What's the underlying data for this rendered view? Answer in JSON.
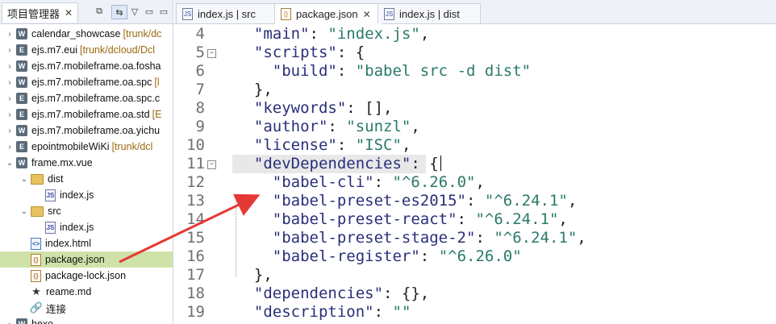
{
  "left_panel": {
    "title": "项目管理器",
    "close": "✕",
    "toolbar": [
      "⧉",
      "⇆",
      "▽",
      "▭",
      "▭"
    ],
    "tree": [
      {
        "twisty": "›",
        "icon": "proj",
        "icon_text": "W",
        "name": "calendar_showcase",
        "meta": "[trunk/dc"
      },
      {
        "twisty": "›",
        "icon": "proj",
        "icon_text": "E",
        "name": "ejs.m7.eui",
        "meta": "[trunk/dcloud/Dcl"
      },
      {
        "twisty": "›",
        "icon": "proj",
        "icon_text": "W",
        "name": "ejs.m7.mobileframe.oa.fosha",
        "meta": ""
      },
      {
        "twisty": "›",
        "icon": "proj",
        "icon_text": "W",
        "name": "ejs.m7.mobileframe.oa.spc",
        "meta": "[l"
      },
      {
        "twisty": "›",
        "icon": "proj",
        "icon_text": "E",
        "name": "ejs.m7.mobileframe.oa.spc.c",
        "meta": ""
      },
      {
        "twisty": "›",
        "icon": "proj",
        "icon_text": "E",
        "name": "ejs.m7.mobileframe.oa.std",
        "meta": "[E"
      },
      {
        "twisty": "›",
        "icon": "proj",
        "icon_text": "W",
        "name": "ejs.m7.mobileframe.oa.yichu",
        "meta": ""
      },
      {
        "twisty": "›",
        "icon": "proj",
        "icon_text": "E",
        "name": "epointmobileWiKi",
        "meta": "[trunk/dcl"
      },
      {
        "twisty": "⌄",
        "icon": "proj",
        "icon_text": "W",
        "name": "frame.mx.vue",
        "meta": ""
      },
      {
        "twisty": "⌄",
        "icon": "folder",
        "icon_text": "",
        "name": "dist",
        "meta": "",
        "indent": 1
      },
      {
        "twisty": "",
        "icon": "file",
        "icon_text": "JS",
        "name": "index.js",
        "meta": "",
        "indent": 2
      },
      {
        "twisty": "⌄",
        "icon": "folder",
        "icon_text": "",
        "name": "src",
        "meta": "",
        "indent": 1
      },
      {
        "twisty": "",
        "icon": "file",
        "icon_text": "JS",
        "name": "index.js",
        "meta": "",
        "indent": 2
      },
      {
        "twisty": "",
        "icon": "html",
        "icon_text": "<>",
        "name": "index.html",
        "meta": "",
        "indent": 1
      },
      {
        "twisty": "",
        "icon": "json",
        "icon_text": "{}",
        "name": "package.json",
        "meta": "",
        "indent": 1,
        "selected": true
      },
      {
        "twisty": "",
        "icon": "json",
        "icon_text": "{}",
        "name": "package-lock.json",
        "meta": "",
        "indent": 1
      },
      {
        "twisty": "",
        "icon": "star",
        "icon_text": "★",
        "name": "reame.md",
        "meta": "",
        "indent": 1
      },
      {
        "twisty": "",
        "icon": "link",
        "icon_text": "🔗",
        "name": "连接",
        "meta": "",
        "indent": 1
      },
      {
        "twisty": "›",
        "icon": "proj",
        "icon_text": "W",
        "name": "hexo",
        "meta": ""
      }
    ]
  },
  "editor": {
    "tabs": [
      {
        "label": "index.js | src",
        "icon": "JS",
        "active": false
      },
      {
        "label": "package.json",
        "icon": "{}",
        "active": true
      },
      {
        "label": "index.js | dist",
        "icon": "JS",
        "active": false
      }
    ],
    "tab_close": "✕",
    "lines": [
      {
        "n": "4",
        "tokens": [
          [
            "p",
            "  "
          ],
          [
            "k",
            "\"main\""
          ],
          [
            "p",
            ": "
          ],
          [
            "s",
            "\"index.js\""
          ],
          [
            "p",
            ","
          ]
        ]
      },
      {
        "n": "5",
        "fold": "−",
        "tokens": [
          [
            "p",
            "  "
          ],
          [
            "k",
            "\"scripts\""
          ],
          [
            "p",
            ": {"
          ]
        ]
      },
      {
        "n": "6",
        "tokens": [
          [
            "p",
            "    "
          ],
          [
            "k",
            "\"build\""
          ],
          [
            "p",
            ": "
          ],
          [
            "s",
            "\"babel src -d dist\""
          ]
        ]
      },
      {
        "n": "7",
        "tokens": [
          [
            "p",
            "  },"
          ]
        ]
      },
      {
        "n": "8",
        "tokens": [
          [
            "p",
            "  "
          ],
          [
            "k",
            "\"keywords\""
          ],
          [
            "p",
            ": [],"
          ]
        ]
      },
      {
        "n": "9",
        "tokens": [
          [
            "p",
            "  "
          ],
          [
            "k",
            "\"author\""
          ],
          [
            "p",
            ": "
          ],
          [
            "s",
            "\"sunzl\""
          ],
          [
            "p",
            ","
          ]
        ]
      },
      {
        "n": "10",
        "tokens": [
          [
            "p",
            "  "
          ],
          [
            "k",
            "\"license\""
          ],
          [
            "p",
            ": "
          ],
          [
            "s",
            "\"ISC\""
          ],
          [
            "p",
            ","
          ]
        ]
      },
      {
        "n": "11",
        "fold": "−",
        "highlight": true,
        "tokens": [
          [
            "p",
            "  "
          ],
          [
            "k",
            "\"devDependencies\""
          ],
          [
            "p",
            ": {"
          ]
        ]
      },
      {
        "n": "12",
        "tokens": [
          [
            "p",
            "    "
          ],
          [
            "k",
            "\"babel-cli\""
          ],
          [
            "p",
            ": "
          ],
          [
            "s",
            "\"^6.26.0\""
          ],
          [
            "p",
            ","
          ]
        ]
      },
      {
        "n": "13",
        "tokens": [
          [
            "p",
            "    "
          ],
          [
            "k",
            "\"babel-preset-es2015\""
          ],
          [
            "p",
            ": "
          ],
          [
            "s",
            "\"^6.24.1\""
          ],
          [
            "p",
            ","
          ]
        ]
      },
      {
        "n": "14",
        "tokens": [
          [
            "p",
            "    "
          ],
          [
            "k",
            "\"babel-preset-react\""
          ],
          [
            "p",
            ": "
          ],
          [
            "s",
            "\"^6.24.1\""
          ],
          [
            "p",
            ","
          ]
        ]
      },
      {
        "n": "15",
        "tokens": [
          [
            "p",
            "    "
          ],
          [
            "k",
            "\"babel-preset-stage-2\""
          ],
          [
            "p",
            ": "
          ],
          [
            "s",
            "\"^6.24.1\""
          ],
          [
            "p",
            ","
          ]
        ]
      },
      {
        "n": "16",
        "tokens": [
          [
            "p",
            "    "
          ],
          [
            "k",
            "\"babel-register\""
          ],
          [
            "p",
            ": "
          ],
          [
            "s",
            "\"^6.26.0\""
          ]
        ]
      },
      {
        "n": "17",
        "tokens": [
          [
            "p",
            "  },"
          ]
        ]
      },
      {
        "n": "18",
        "tokens": [
          [
            "p",
            "  "
          ],
          [
            "k",
            "\"dependencies\""
          ],
          [
            "p",
            ": {},"
          ]
        ]
      },
      {
        "n": "19",
        "tokens": [
          [
            "p",
            "  "
          ],
          [
            "k",
            "\"description\""
          ],
          [
            "p",
            ": "
          ],
          [
            "s",
            "\"\""
          ]
        ]
      }
    ]
  },
  "colors": {
    "accent_arrow": "#e53935",
    "selection": "#cfe3a8",
    "key": "#2a2f7a",
    "string": "#2a7a6a"
  }
}
